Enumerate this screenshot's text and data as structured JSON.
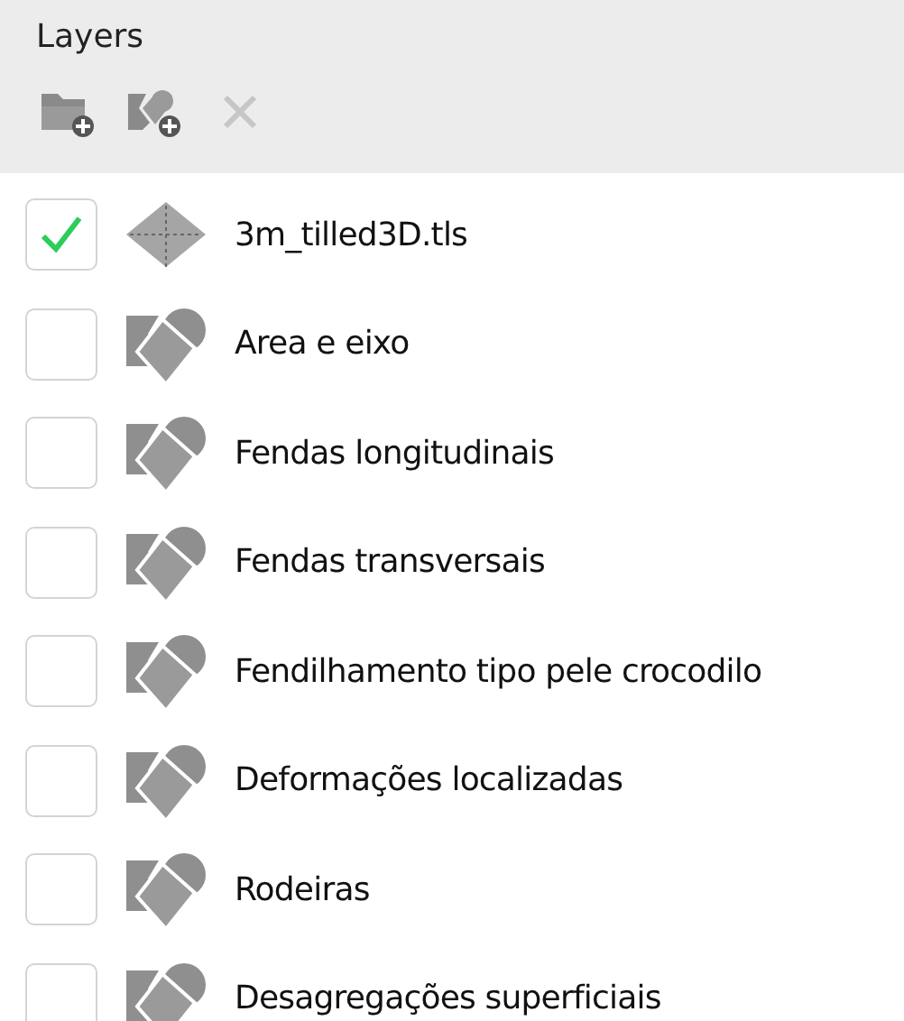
{
  "panel": {
    "title": "Layers"
  },
  "toolbar": [
    {
      "kind": "add-group",
      "disabled": false
    },
    {
      "kind": "add-layer",
      "disabled": false
    },
    {
      "kind": "remove",
      "disabled": true
    }
  ],
  "layers": [
    {
      "name": "3m_tilled3D.tls",
      "kind": "pointcloud",
      "checked": true
    },
    {
      "name": "Area e eixo",
      "kind": "vector",
      "checked": false
    },
    {
      "name": "Fendas longitudinais",
      "kind": "vector",
      "checked": false
    },
    {
      "name": "Fendas transversais",
      "kind": "vector",
      "checked": false
    },
    {
      "name": "Fendilhamento tipo pele crocodilo",
      "kind": "vector",
      "checked": false
    },
    {
      "name": "Deformações localizadas",
      "kind": "vector",
      "checked": false
    },
    {
      "name": "Rodeiras",
      "kind": "vector",
      "checked": false
    },
    {
      "name": "Desagregações superficiais",
      "kind": "vector",
      "checked": false
    }
  ]
}
